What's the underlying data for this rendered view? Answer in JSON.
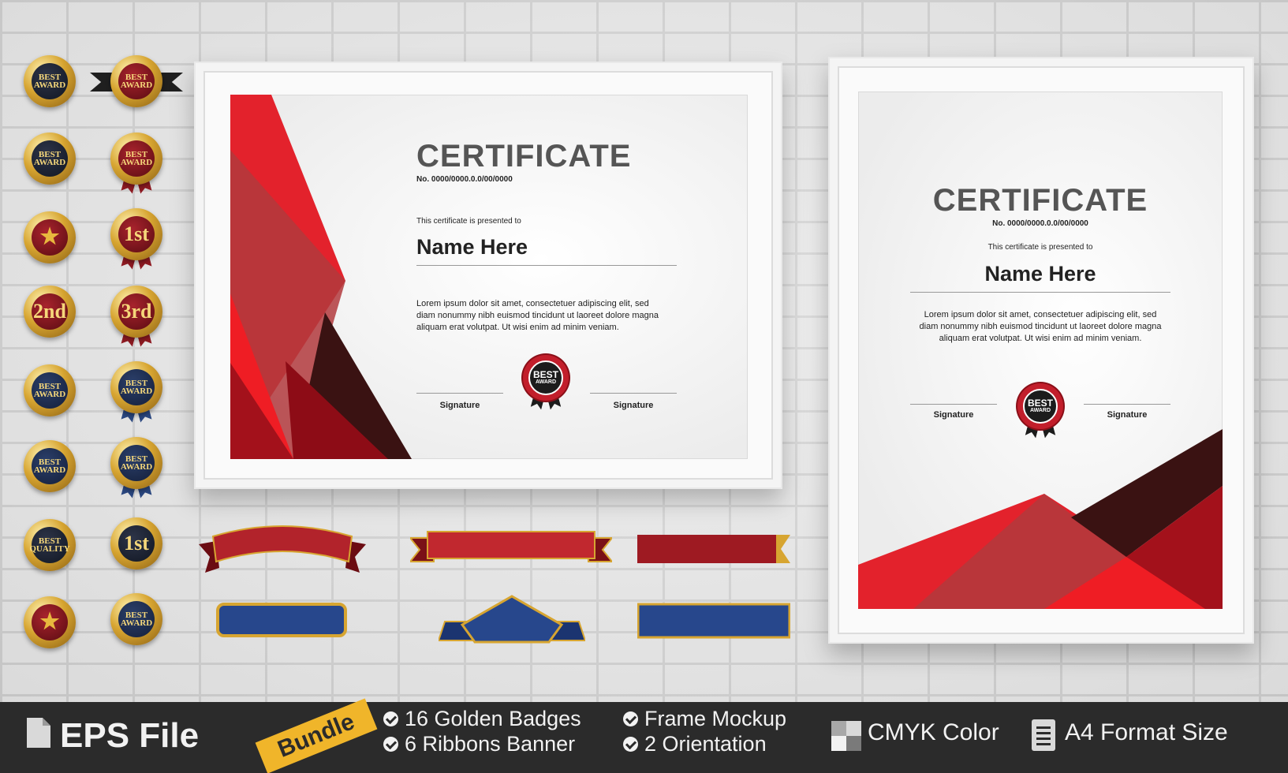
{
  "badges": [
    {
      "id": "b1",
      "lines": [
        "BEST",
        "AWARD"
      ]
    },
    {
      "id": "b2",
      "lines": [
        "BEST",
        "AWARD"
      ]
    },
    {
      "id": "b3",
      "lines": [
        "BEST",
        "AWARD"
      ]
    },
    {
      "id": "b4",
      "lines": [
        "BEST",
        "AWARD"
      ]
    },
    {
      "id": "b5",
      "lines": []
    },
    {
      "id": "b6",
      "lines": [
        "1st"
      ]
    },
    {
      "id": "b7",
      "lines": [
        "2nd"
      ]
    },
    {
      "id": "b8",
      "lines": [
        "3rd"
      ]
    },
    {
      "id": "b9",
      "lines": [
        "BEST",
        "AWARD"
      ]
    },
    {
      "id": "b10",
      "lines": [
        "BEST",
        "AWARD"
      ]
    },
    {
      "id": "b11",
      "lines": [
        "BEST",
        "AWARD"
      ]
    },
    {
      "id": "b12",
      "lines": [
        "BEST",
        "AWARD"
      ]
    },
    {
      "id": "b13",
      "lines": [
        "BEST",
        "QUALITY"
      ]
    },
    {
      "id": "b14",
      "lines": [
        "1st"
      ]
    },
    {
      "id": "b15",
      "lines": []
    },
    {
      "id": "b16",
      "lines": [
        "BEST",
        "AWARD"
      ]
    }
  ],
  "landscape": {
    "title": "CERTIFICATE",
    "number": "No. 0000/0000.0.0/00/0000",
    "presented": "This certificate is presented to",
    "name": "Name Here",
    "body_1": "Lorem ipsum dolor sit amet, consectetuer adipiscing elit, sed",
    "body_2": "diam nonummy nibh euismod tincidunt ut laoreet dolore magna",
    "body_3": "aliquam erat volutpat. Ut wisi enim ad minim veniam.",
    "signature_left": "Signature",
    "signature_right": "Signature",
    "seal_top": "BEST",
    "seal_bottom": "AWARD"
  },
  "portrait": {
    "title": "CERTIFICATE",
    "number": "No. 0000/0000.0.0/00/0000",
    "presented": "This certificate is presented to",
    "name": "Name Here",
    "body_1": "Lorem ipsum dolor sit amet, consectetuer adipiscing elit, sed",
    "body_2": "diam nonummy nibh euismod tincidunt ut laoreet dolore magna",
    "body_3": "aliquam erat volutpat. Ut wisi enim ad minim veniam.",
    "signature_left": "Signature",
    "signature_right": "Signature",
    "seal_top": "BEST",
    "seal_bottom": "AWARD"
  },
  "footer": {
    "file_icon": "file-icon",
    "file_label": "EPS File",
    "bundle_label": "Bundle",
    "features": [
      "16 Golden Badges",
      "6  Ribbons Banner",
      "Frame Mockup",
      "2 Orientation"
    ],
    "cmyk_label": "CMYK Color",
    "a4_label": "A4 Format Size"
  },
  "colors": {
    "accent_red": "#d4212b",
    "dark_maroon": "#3a1212",
    "gold": "#d7a531",
    "navy_ribbon": "#27478c",
    "footer_bg": "#2b2b2b",
    "bundle_tag": "#f0b52a"
  }
}
